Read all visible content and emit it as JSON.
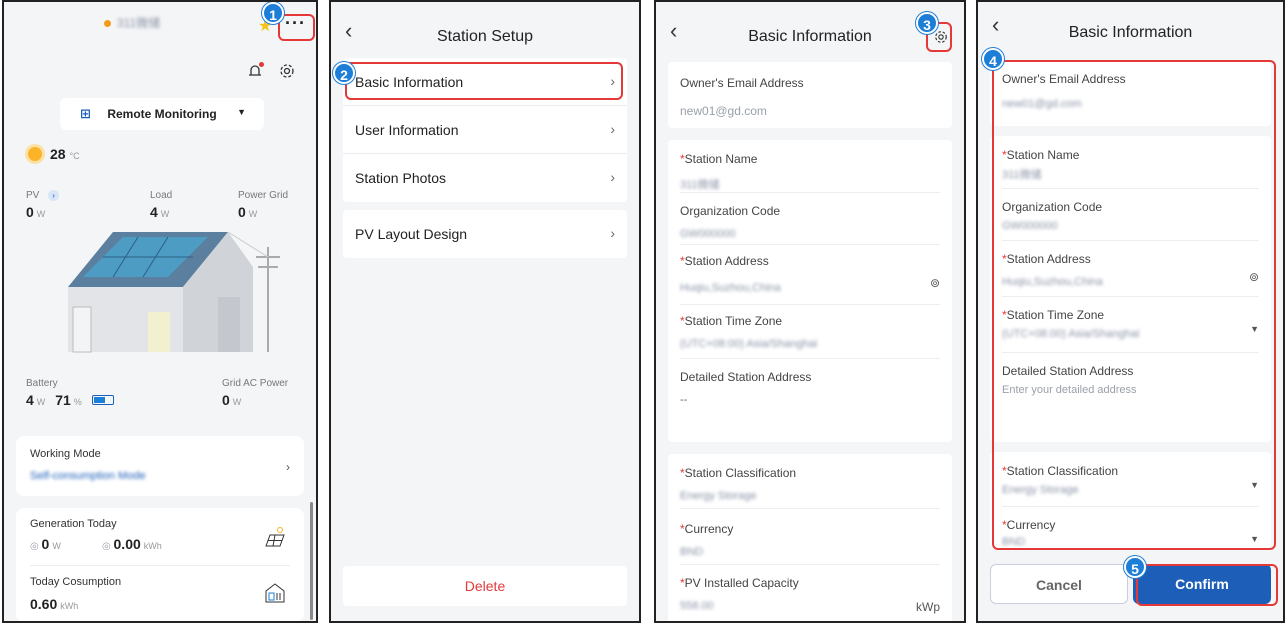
{
  "screen1": {
    "station_name": "311微储",
    "mode_label": "Remote Monitoring",
    "temperature": "28",
    "temp_unit": "°C",
    "pv_label": "PV",
    "pv_value": "0",
    "pv_unit": "W",
    "load_label": "Load",
    "load_value": "4",
    "load_unit": "W",
    "grid_label": "Power Grid",
    "grid_value": "0",
    "grid_unit": "W",
    "battery_label": "Battery",
    "battery_value": "4",
    "battery_unit": "W",
    "battery_soc": "71",
    "battery_soc_unit": "%",
    "gridac_label": "Grid AC Power",
    "gridac_value": "0",
    "gridac_unit": "W",
    "working_mode_label": "Working Mode",
    "working_mode_value": "Self-consumption Mode",
    "gen_today_label": "Generation Today",
    "gen_today_power": "0",
    "gen_today_power_unit": "W",
    "gen_today_energy": "0.00",
    "gen_today_energy_unit": "kWh",
    "consumption_label": "Today Cosumption",
    "consumption_value": "0.60",
    "consumption_unit": "kWh",
    "colors": {
      "accent": "#1d5fb8",
      "orange": "#f59b1b"
    }
  },
  "screen2": {
    "title": "Station Setup",
    "items": [
      {
        "label": "Basic Information"
      },
      {
        "label": "User Information"
      },
      {
        "label": "Station Photos"
      },
      {
        "label": "PV Layout Design"
      }
    ],
    "delete_label": "Delete"
  },
  "screen3": {
    "title": "Basic Information",
    "email_label": "Owner's Email Address",
    "email_value": "new01@gd.com",
    "station_name_label": "Station Name",
    "station_name_value": "311微储",
    "org_code_label": "Organization Code",
    "org_code_value": "GW000000",
    "address_label": "Station Address",
    "address_value": "Huqiu,Suzhou,China",
    "tz_label": "Station Time Zone",
    "tz_value": "(UTC+08:00) Asia/Shanghai",
    "detail_addr_label": "Detailed Station Address",
    "detail_addr_value": "--",
    "class_label": "Station Classification",
    "class_value": "Energy Storage",
    "currency_label": "Currency",
    "currency_value": "BND",
    "capacity_label": "PV Installed Capacity",
    "capacity_value": "558.00",
    "capacity_unit": "kWp"
  },
  "screen4": {
    "title": "Basic Information",
    "email_label": "Owner's Email Address",
    "email_value": "new01@gd.com",
    "station_name_label": "Station Name",
    "station_name_value": "311微储",
    "org_code_label": "Organization Code",
    "org_code_value": "GW000000",
    "address_label": "Station Address",
    "address_value": "Huqiu,Suzhou,China",
    "tz_label": "Station Time Zone",
    "tz_value": "(UTC+08:00) Asia/Shanghai",
    "detail_addr_label": "Detailed Station Address",
    "detail_addr_placeholder": "Enter your detailed address",
    "class_label": "Station Classification",
    "class_value": "Energy Storage",
    "currency_label": "Currency",
    "currency_value": "BND",
    "cancel_label": "Cancel",
    "confirm_label": "Confirm"
  },
  "badges": [
    "1",
    "2",
    "3",
    "4",
    "5"
  ],
  "icons": [
    "more-icon",
    "star-icon",
    "bell-icon",
    "gear-icon",
    "chevron-right-icon",
    "back-icon",
    "location-pin-icon",
    "dropdown-arrow-icon",
    "sun-icon",
    "solar-panel-icon",
    "house-icon"
  ]
}
